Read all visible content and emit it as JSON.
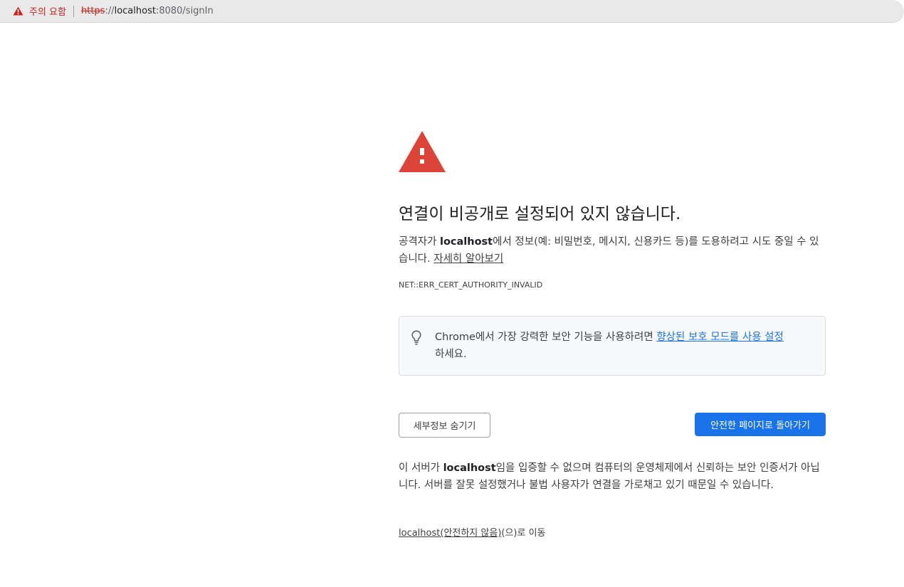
{
  "address_bar": {
    "security_label": "주의 요함",
    "url_scheme": "https",
    "url_separator": "://",
    "url_host": "localhost",
    "url_rest": ":8080/signIn"
  },
  "interstitial": {
    "heading": "연결이 비공개로 설정되어 있지 않습니다.",
    "para_prefix": "공격자가 ",
    "para_host": "localhost",
    "para_suffix": "에서 정보(예: 비밀번호, 메시지, 신용카드 등)를 도용하려고 시도 중일 수 있습니다. ",
    "learn_more_link": "자세히 알아보기",
    "error_code": "NET::ERR_CERT_AUTHORITY_INVALID",
    "tip_prefix": "Chrome에서 가장 강력한 보안 기능을 사용하려면 ",
    "tip_link": "향상된 보호 모드를 사용 설정",
    "tip_suffix": "하세요.",
    "hide_details_button": "세부정보 숨기기",
    "back_to_safety_button": "안전한 페이지로 돌아가기",
    "details_prefix": "이 서버가 ",
    "details_host": "localhost",
    "details_suffix": "임을 입증할 수 없으며 컴퓨터의 운영체제에서 신뢰하는 보안 인증서가 아닙니다. 서버를 잘못 설정했거나 불법 사용자가 연결을 가로채고 있기 때문일 수 있습니다.",
    "proceed_link": "localhost(안전하지 않음)",
    "proceed_suffix": "(으)로 이동"
  },
  "colors": {
    "warning_red": "#d93025",
    "primary_blue": "#1a73e8"
  },
  "icons": {
    "address_warning": "warning-triangle-icon",
    "main_warning": "warning-triangle-icon",
    "tip": "lightbulb-icon"
  }
}
